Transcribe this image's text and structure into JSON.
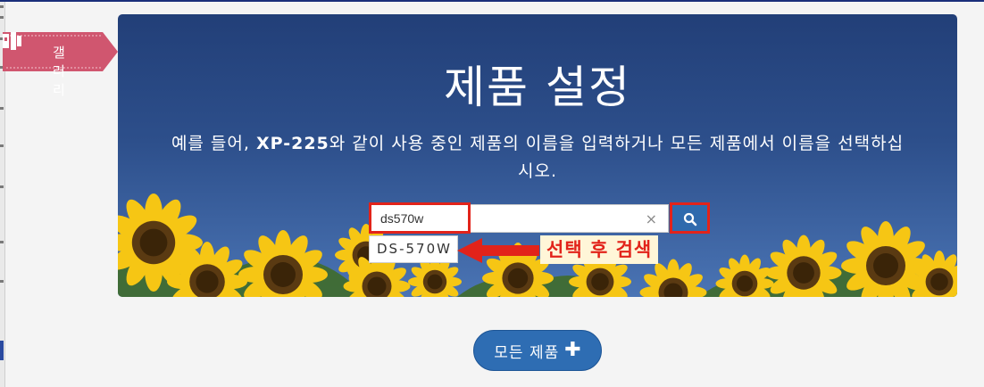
{
  "gallery_tab": {
    "label": "갤러리",
    "icon": "gallery-icon"
  },
  "hero": {
    "title": "제품 설정",
    "description_prefix": "예를 들어, ",
    "description_model": "XP-225",
    "description_suffix": "와 같이 사용 중인 제품의 이름을 입력하거나 모든 제품에서 이름을 선택하십시오."
  },
  "search": {
    "value": "ds570w",
    "clear_icon": "×",
    "button_icon": "search-icon"
  },
  "suggestion": {
    "label": "DS-570W"
  },
  "annotation": {
    "label": "선택 후 검색"
  },
  "all_products_button": {
    "label": "모든 제품",
    "icon": "plus-icon"
  },
  "colors": {
    "hero_sky": "#2d4f8b",
    "search_button": "#2f6aad",
    "annotation_red": "#e2231a",
    "gallery_ribbon": "#d0566f",
    "primary_button": "#2e6db3"
  }
}
